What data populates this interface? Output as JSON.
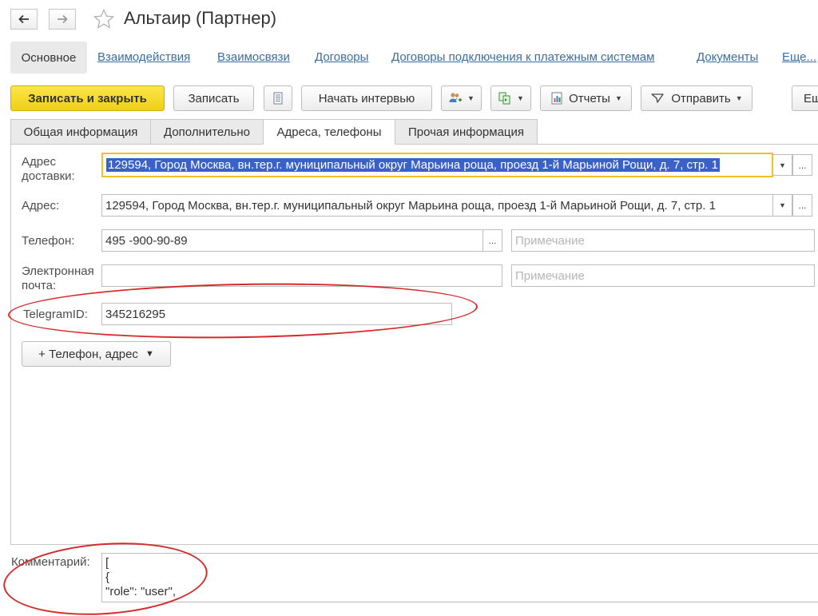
{
  "window": {
    "title": "Альтаир (Партнер)"
  },
  "nav": {
    "current": "Основное",
    "links": [
      "Взаимодействия",
      "Взаимосвязи",
      "Договоры",
      "Договоры подключения к платежным системам",
      "Документы",
      "Еще..."
    ]
  },
  "toolbar": {
    "save_close": "Записать и закрыть",
    "save": "Записать",
    "start_interview": "Начать интервью",
    "reports": "Отчеты",
    "send": "Отправить",
    "more": "Ещ"
  },
  "tabs": [
    "Общая информация",
    "Дополнительно",
    "Адреса, телефоны",
    "Прочая информация"
  ],
  "form": {
    "delivery_address_label": "Адрес доставки:",
    "delivery_address_value": "129594, Город Москва, вн.тер.г. муниципальный округ Марьина роща, проезд 1-й Марьиной Рощи, д. 7, стр. 1",
    "address_label": "Адрес:",
    "address_value": "129594, Город Москва, вн.тер.г. муниципальный округ Марьина роща, проезд 1-й Марьиной Рощи, д. 7, стр. 1",
    "phone_label": "Телефон:",
    "phone_value": "495 -900-90-89",
    "phone_note_placeholder": "Примечание",
    "email_label": "Электронная почта:",
    "email_value": "",
    "email_note_placeholder": "Примечание",
    "telegram_label": "TelegramID:",
    "telegram_value": "345216295",
    "add_button": "+ Телефон, адрес",
    "comment_label": "Комментарий:",
    "comment_lines": [
      "[",
      "{",
      "\"role\": \"user\","
    ]
  },
  "colors": {
    "primary_button": "#f5d92a",
    "link": "#3a6ea5",
    "selection": "#3a61c7",
    "annotation": "#d62a2a"
  }
}
